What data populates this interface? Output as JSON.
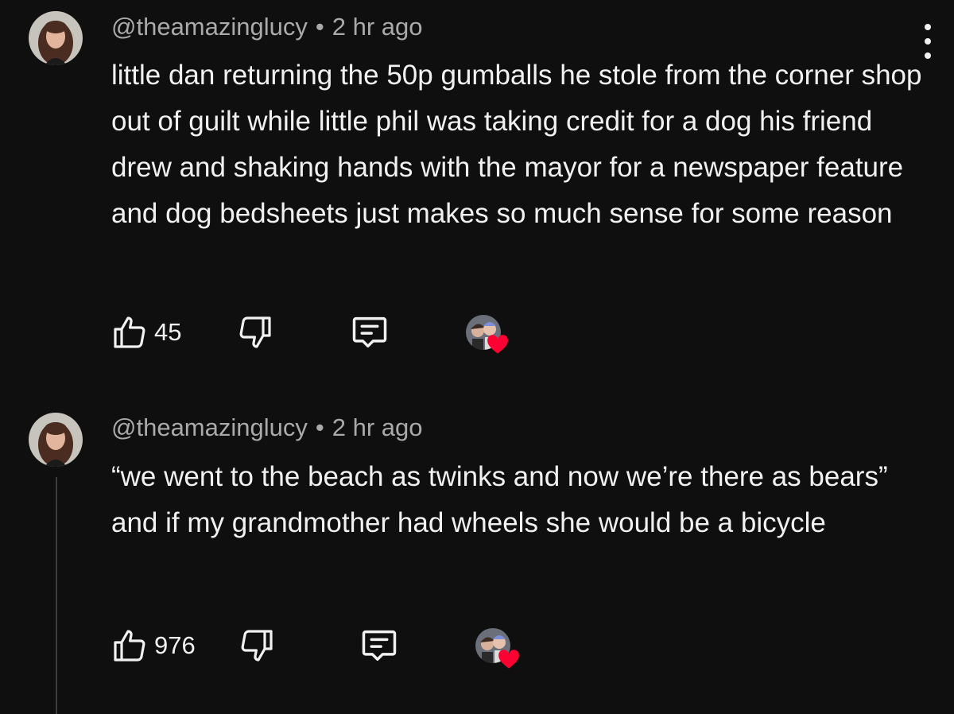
{
  "comments": [
    {
      "author": "@theamazinglucy",
      "separator": "•",
      "time": "2 hr ago",
      "text": "little dan returning the 50p gumballs he stole from the corner shop out of guilt while little phil was taking credit for a dog his friend drew and shaking hands with the mayor for a newspaper feature and dog bedsheets just makes so much sense for some reason",
      "likes": "45"
    },
    {
      "author": "@theamazinglucy",
      "separator": "•",
      "time": "2 hr ago",
      "text": "“we went to the beach as twinks and now we’re there as bears” and if my grandmother had wheels she would be a bicycle",
      "likes": "976"
    }
  ],
  "icons": {
    "like": "thumbs-up-icon",
    "dislike": "thumbs-down-icon",
    "reply": "comment-reply-icon",
    "more": "more-vertical-icon",
    "heart": "heart-icon"
  },
  "colors": {
    "background": "#0f0f0f",
    "text": "#f1f1f1",
    "meta": "#aaaaaa",
    "heart": "#ff0033"
  }
}
